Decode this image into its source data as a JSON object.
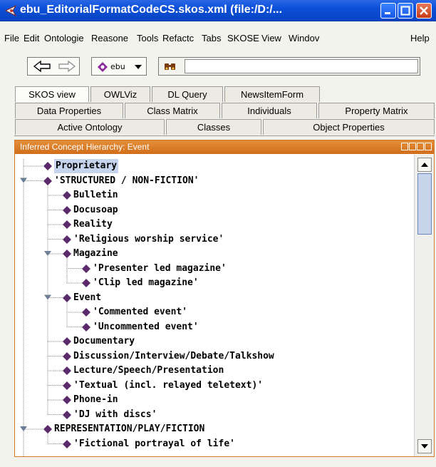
{
  "window": {
    "title": "ebu_EditorialFormatCodeCS.skos.xml (file:/D:/...",
    "min_icon": "minimize-icon",
    "max_icon": "maximize-icon",
    "close_icon": "close-icon"
  },
  "menu": [
    "File",
    "Edit",
    "Ontologie",
    "Reasone",
    "Tools",
    "Refactc",
    "Tabs",
    "SKOSE",
    "View",
    "Windov",
    "Help"
  ],
  "toolbar": {
    "back_icon": "back-arrow-icon",
    "forward_icon": "forward-arrow-icon",
    "ontology_label": "ebu",
    "find_icon": "binoculars-icon",
    "find_value": ""
  },
  "tabs": {
    "row1": [
      "SKOS view",
      "OWLViz",
      "DL Query",
      "NewsItemForm"
    ],
    "row2": [
      "Data Properties",
      "Class Matrix",
      "Individuals",
      "Property Matrix"
    ],
    "row3": [
      "Active Ontology",
      "Classes",
      "Object Properties"
    ],
    "selected": "SKOS view"
  },
  "panel": {
    "title": "Inferred Concept Hierarchy: Event",
    "accent": "#d0741f"
  },
  "tree": {
    "item_color": "#5b2a6b",
    "items": [
      {
        "label": "Proprietary",
        "selected": true
      },
      {
        "label": "'STRUCTURED / NON-FICTION'",
        "expanded": true
      },
      {
        "label": "Bulletin"
      },
      {
        "label": "Docusoap"
      },
      {
        "label": "Reality"
      },
      {
        "label": "'Religious worship service'"
      },
      {
        "label": "Magazine",
        "expanded": true
      },
      {
        "label": "'Presenter led magazine'"
      },
      {
        "label": "'Clip led magazine'"
      },
      {
        "label": "Event",
        "expanded": true
      },
      {
        "label": "'Commented event'"
      },
      {
        "label": "'Uncommented event'"
      },
      {
        "label": "Documentary"
      },
      {
        "label": "Discussion/Interview/Debate/Talkshow"
      },
      {
        "label": "Lecture/Speech/Presentation"
      },
      {
        "label": "'Textual (incl. relayed teletext)'"
      },
      {
        "label": "Phone-in"
      },
      {
        "label": "'DJ with discs'"
      },
      {
        "label": "REPRESENTATION/PLAY/FICTION",
        "expanded": true
      },
      {
        "label": "'Fictional portrayal of life'"
      }
    ]
  }
}
